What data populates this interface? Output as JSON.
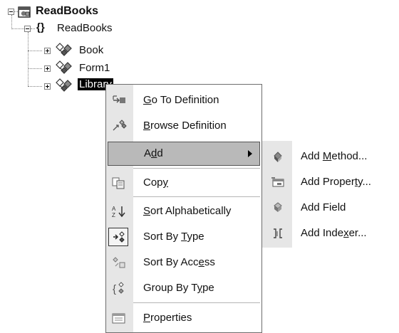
{
  "tree": {
    "root_label": "ReadBooks",
    "namespace_label": "ReadBooks",
    "namespace_glyph": "{}",
    "items": [
      {
        "label": "Book"
      },
      {
        "label": "Form1"
      },
      {
        "label": "Library"
      }
    ]
  },
  "context_menu": {
    "items": [
      {
        "label": "Go To Definition",
        "underline": "G"
      },
      {
        "label": "Browse Definition",
        "underline": "B"
      },
      {
        "label": "Add",
        "underline": "d",
        "has_submenu": true,
        "highlighted": true
      },
      {
        "label": "Copy",
        "underline": "y"
      },
      {
        "label": "Sort Alphabetically",
        "underline": "S"
      },
      {
        "label": "Sort By Type",
        "underline": "T",
        "checked": true
      },
      {
        "label": "Sort By Access",
        "underline": "e"
      },
      {
        "label": "Group By Type",
        "underline": "y"
      },
      {
        "label": "Properties",
        "underline": "P"
      }
    ]
  },
  "submenu": {
    "items": [
      {
        "label": "Add Method...",
        "underline": "M"
      },
      {
        "label": "Add Property...",
        "underline": "t"
      },
      {
        "label": "Add Field",
        "underline": ""
      },
      {
        "label": "Add Indexer...",
        "underline": "x"
      }
    ]
  }
}
